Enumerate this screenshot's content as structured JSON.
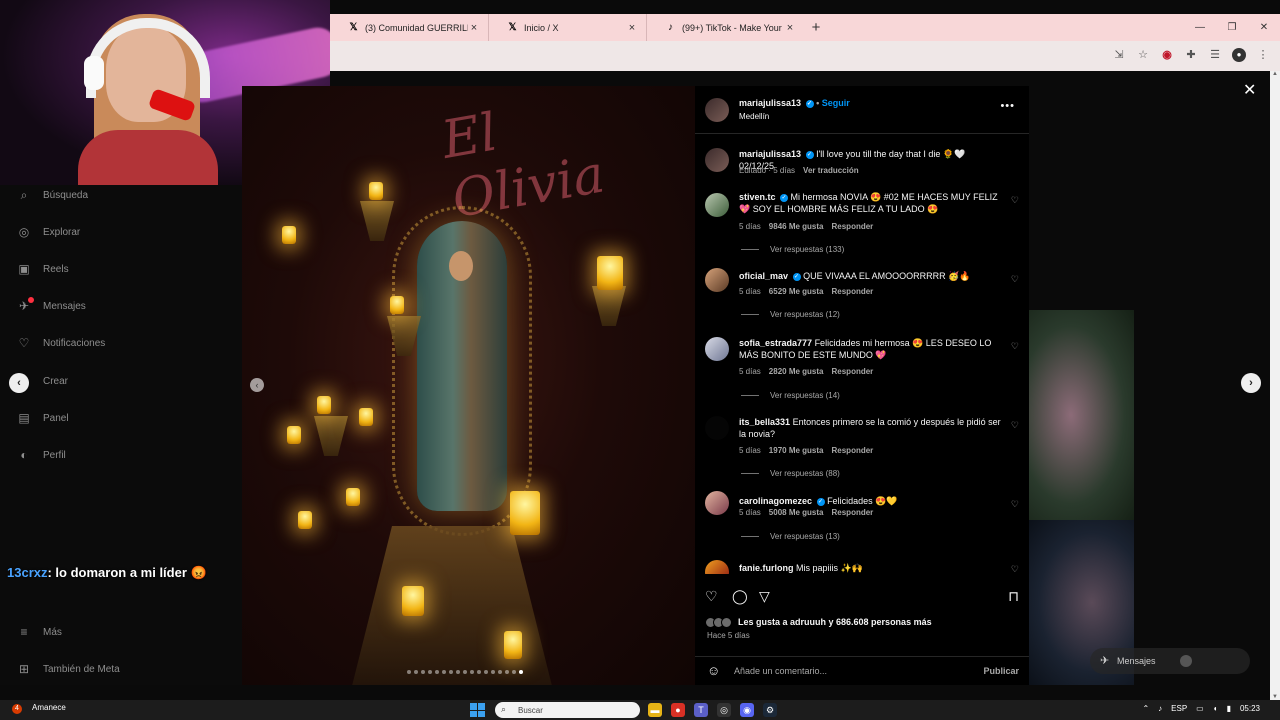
{
  "browser": {
    "tabs": [
      {
        "icon": "x-icon",
        "label": "(3) Comunidad GUERRILLA TC"
      },
      {
        "icon": "x-icon",
        "label": "Inicio / X"
      },
      {
        "icon": "tiktok-icon",
        "label": "(99+) TikTok - Make Your Day"
      }
    ],
    "new_tab": "+",
    "window_controls": {
      "minimize": "—",
      "maximize": "❐",
      "close": "✕"
    }
  },
  "instagram_nav": {
    "items": [
      {
        "icon": "search-icon",
        "label": "Búsqueda"
      },
      {
        "icon": "explore-icon",
        "label": "Explorar"
      },
      {
        "icon": "reels-icon",
        "label": "Reels"
      },
      {
        "icon": "messages-icon",
        "label": "Mensajes"
      },
      {
        "icon": "heart-icon",
        "label": "Notificaciones"
      },
      {
        "icon": "plus-icon",
        "label": "Crear"
      },
      {
        "icon": "dashboard-icon",
        "label": "Panel"
      },
      {
        "icon": "profile-icon",
        "label": "Perfil"
      }
    ],
    "more": "Más",
    "also_from_meta": "También de Meta"
  },
  "stream_chat": {
    "user": "13crxz",
    "message": ": lo domaron a mi líder 😡"
  },
  "post": {
    "author": "mariajulissa13",
    "follow_label": "Seguir",
    "location": "Medellín",
    "caption": {
      "author": "mariajulissa13",
      "text": "I'll love you till the day that I die 🌻🤍 02/12/25",
      "meta_edited": "Editado · 5 días",
      "meta_translate": "Ver traducción"
    },
    "neon_sign": "El Olivia"
  },
  "comments": [
    {
      "user": "stiven.tc",
      "verified": true,
      "text": "Mi hermosa NOVIA 😍 #02 ME HACES MUY FELIZ 💖 SOY EL HOMBRE MÁS FELIZ A TU LADO 😍",
      "age": "5 días",
      "likes": "9846 Me gusta",
      "reply": "Responder",
      "replies": "Ver respuestas (133)"
    },
    {
      "user": "oficial_mav",
      "verified": true,
      "text": "QUE VIVAAA EL AMOOOORRRRR 🥳🔥",
      "age": "5 días",
      "likes": "6529 Me gusta",
      "reply": "Responder",
      "replies": "Ver respuestas (12)"
    },
    {
      "user": "sofia_estrada777",
      "verified": false,
      "text": "Felicidades mi hermosa 😍 LES DESEO LO MÁS BONITO DE ESTE MUNDO 💖",
      "age": "5 días",
      "likes": "2820 Me gusta",
      "reply": "Responder",
      "replies": "Ver respuestas (14)"
    },
    {
      "user": "its_bella331",
      "verified": false,
      "text": "Entonces primero se la comió y después le pidió ser la novia?",
      "age": "5 días",
      "likes": "1970 Me gusta",
      "reply": "Responder",
      "replies": "Ver respuestas (88)"
    },
    {
      "user": "carolinagomezec",
      "verified": true,
      "text": "Felicidades 😍💛",
      "age": "5 días",
      "likes": "5008 Me gusta",
      "reply": "Responder",
      "replies": "Ver respuestas (13)"
    },
    {
      "user": "fanie.furlong",
      "verified": false,
      "text": "Mis papiiis ✨🙌",
      "age": "",
      "likes": "",
      "reply": "",
      "replies": ""
    }
  ],
  "engagement": {
    "likes_text": "Les gusta a adruuuh y 686.608 personas más",
    "ago": "Hace 5 días",
    "add_comment_placeholder": "Añade un comentario...",
    "publish": "Publicar"
  },
  "messages_pill": "Mensajes",
  "taskbar": {
    "weather_badge": "4",
    "weather_label": "Amanece",
    "search_label": "Buscar",
    "lang": "ESP",
    "time": "05:23"
  }
}
